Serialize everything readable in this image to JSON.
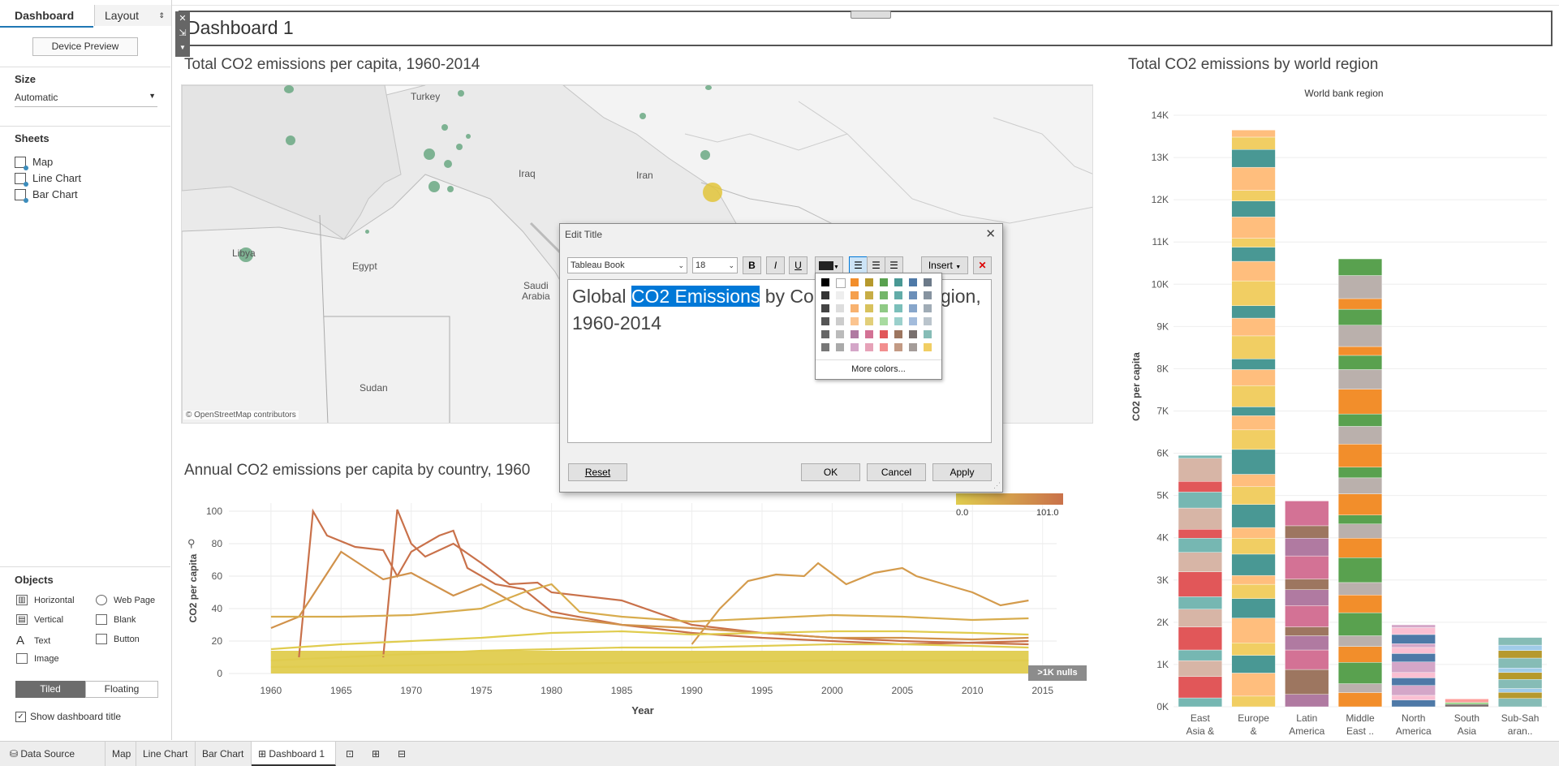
{
  "left_pane": {
    "tab_dashboard": "Dashboard",
    "tab_layout": "Layout",
    "device_preview": "Device Preview",
    "size_label": "Size",
    "size_value": "Automatic",
    "sheets_label": "Sheets",
    "sheets": [
      {
        "label": "Map"
      },
      {
        "label": "Line Chart"
      },
      {
        "label": "Bar Chart"
      }
    ],
    "objects_label": "Objects",
    "objects": [
      {
        "label": "Horizontal",
        "icon": "horizontal-icon"
      },
      {
        "label": "Web Page",
        "icon": "globe-icon"
      },
      {
        "label": "Vertical",
        "icon": "vertical-icon"
      },
      {
        "label": "Blank",
        "icon": "blank-icon"
      },
      {
        "label": "Text",
        "icon": "text-icon"
      },
      {
        "label": "Button",
        "icon": "button-icon"
      },
      {
        "label": "Image",
        "icon": "image-icon"
      }
    ],
    "tiled": "Tiled",
    "floating": "Floating",
    "show_title": "Show dashboard title"
  },
  "dashboard": {
    "title": "Dashboard 1",
    "map_title": "Total CO2 emissions per capita, 1960-2014",
    "map_attribution": "© OpenStreetMap contributors",
    "map_labels": {
      "turkey": "Turkey",
      "iraq": "Iraq",
      "iran": "Iran",
      "libya": "Libya",
      "egypt": "Egypt",
      "saudi": "Saudi",
      "arabia": "Arabia",
      "sudan": "Sudan"
    },
    "line_title": "Annual CO2 emissions per capita by country, 1960",
    "bar_title": "Total CO2 emissions by world region"
  },
  "dialog": {
    "title": "Edit Title",
    "font": "Tableau Book",
    "size": "18",
    "bold": "B",
    "italic": "I",
    "underline": "U",
    "insert": "Insert",
    "text_pre": "Global ",
    "text_sel": "CO2 Emissions",
    "text_mid": " by Co",
    "text_post": "gion,",
    "text_line2": "1960-2014",
    "more_colors": "More colors...",
    "reset": "Reset",
    "ok": "OK",
    "cancel": "Cancel",
    "apply": "Apply"
  },
  "legend": {
    "title_partial": "pita",
    "min": "0.0",
    "max": "101.0",
    "nulls": ">1K nulls"
  },
  "bottom_tabs": [
    {
      "label": "Data Source"
    },
    {
      "label": "Map"
    },
    {
      "label": "Line Chart"
    },
    {
      "label": "Bar Chart"
    },
    {
      "label": "Dashboard 1"
    }
  ],
  "colors": {
    "accent": "#0078d7",
    "map_dot": "#6aa882",
    "line_low": "#e0cc4e",
    "line_high": "#c9714a"
  },
  "chart_data": [
    {
      "type": "line",
      "title": "Annual CO2 emissions per capita by country, 1960",
      "xlabel": "Year",
      "ylabel": "CO2 per capita",
      "x_ticks": [
        "1960",
        "1965",
        "1970",
        "1975",
        "1980",
        "1985",
        "1990",
        "1995",
        "2000",
        "2005",
        "2010",
        "2015"
      ],
      "y_ticks": [
        "0",
        "20",
        "40",
        "60",
        "80",
        "100"
      ],
      "xlim": [
        1957,
        2016
      ],
      "ylim": [
        0,
        105
      ],
      "grid": true,
      "series": [
        {
          "values": [
            [
              1962,
              10
            ],
            [
              1963,
              100
            ],
            [
              1964,
              85
            ],
            [
              1966,
              78
            ],
            [
              1968,
              76
            ],
            [
              1969,
              60
            ],
            [
              1970,
              75
            ],
            [
              1972,
              85
            ],
            [
              1973,
              88
            ],
            [
              1974,
              65
            ],
            [
              1976,
              55
            ],
            [
              1978,
              52
            ],
            [
              1980,
              38
            ],
            [
              1985,
              30
            ],
            [
              1990,
              25
            ],
            [
              1995,
              22
            ],
            [
              2000,
              20
            ],
            [
              2005,
              18
            ],
            [
              2010,
              19
            ],
            [
              2014,
              20
            ]
          ]
        },
        {
          "values": [
            [
              1968,
              10
            ],
            [
              1969,
              101
            ],
            [
              1970,
              80
            ],
            [
              1971,
              72
            ],
            [
              1973,
              80
            ],
            [
              1975,
              68
            ],
            [
              1977,
              55
            ],
            [
              1979,
              56
            ],
            [
              1980,
              50
            ],
            [
              1985,
              45
            ],
            [
              1990,
              30
            ],
            [
              1995,
              25
            ],
            [
              2000,
              22
            ],
            [
              2005,
              20
            ],
            [
              2014,
              18
            ]
          ]
        },
        {
          "values": [
            [
              1960,
              28
            ],
            [
              1962,
              35
            ],
            [
              1965,
              75
            ],
            [
              1968,
              58
            ],
            [
              1970,
              62
            ],
            [
              1973,
              48
            ],
            [
              1975,
              55
            ],
            [
              1978,
              40
            ],
            [
              1980,
              35
            ],
            [
              1985,
              30
            ],
            [
              1990,
              28
            ],
            [
              1995,
              25
            ],
            [
              2000,
              22
            ],
            [
              2005,
              22
            ],
            [
              2010,
              21
            ],
            [
              2014,
              22
            ]
          ]
        },
        {
          "values": [
            [
              1990,
              18
            ],
            [
              1992,
              40
            ],
            [
              1994,
              57
            ],
            [
              1996,
              61
            ],
            [
              1998,
              60
            ],
            [
              1999,
              68
            ],
            [
              2001,
              55
            ],
            [
              2003,
              62
            ],
            [
              2005,
              65
            ],
            [
              2006,
              60
            ],
            [
              2008,
              55
            ],
            [
              2010,
              50
            ],
            [
              2012,
              42
            ],
            [
              2014,
              45
            ]
          ]
        },
        {
          "values": [
            [
              1960,
              35
            ],
            [
              1965,
              35
            ],
            [
              1970,
              36
            ],
            [
              1975,
              40
            ],
            [
              1978,
              50
            ],
            [
              1980,
              55
            ],
            [
              1982,
              38
            ],
            [
              1985,
              35
            ],
            [
              1990,
              32
            ],
            [
              1995,
              34
            ],
            [
              2000,
              36
            ],
            [
              2005,
              35
            ],
            [
              2010,
              33
            ],
            [
              2014,
              34
            ]
          ]
        },
        {
          "values": [
            [
              1960,
              15
            ],
            [
              1965,
              18
            ],
            [
              1970,
              20
            ],
            [
              1975,
              22
            ],
            [
              1980,
              25
            ],
            [
              1985,
              26
            ],
            [
              1990,
              24
            ],
            [
              1995,
              25
            ],
            [
              2000,
              26
            ],
            [
              2005,
              26
            ],
            [
              2010,
              25
            ],
            [
              2014,
              24
            ]
          ]
        },
        {
          "values": [
            [
              1960,
              8
            ],
            [
              1965,
              10
            ],
            [
              1970,
              12
            ],
            [
              1975,
              14
            ],
            [
              1980,
              15
            ],
            [
              1985,
              16
            ],
            [
              1990,
              16
            ],
            [
              1995,
              17
            ],
            [
              2000,
              18
            ],
            [
              2005,
              18
            ],
            [
              2010,
              17
            ],
            [
              2014,
              16
            ]
          ]
        },
        {
          "values": [
            [
              1960,
              4
            ],
            [
              1970,
              5
            ],
            [
              1980,
              6
            ],
            [
              1990,
              7
            ],
            [
              2000,
              8
            ],
            [
              2010,
              8
            ],
            [
              2014,
              8
            ]
          ]
        }
      ]
    },
    {
      "type": "bar",
      "title": "Total CO2 emissions by world region",
      "legend_title": "World bank region",
      "ylabel": "CO2 per capita",
      "categories": [
        "East Asia & Pacific",
        "Europe & Central ..",
        "Latin America ..",
        "Middle East ..",
        "North America",
        "South Asia",
        "Sub-Sah aran.."
      ],
      "values": [
        5950,
        13650,
        4870,
        10600,
        1940,
        190,
        1640
      ],
      "y_ticks": [
        "0K",
        "1K",
        "2K",
        "3K",
        "4K",
        "5K",
        "6K",
        "7K",
        "8K",
        "9K",
        "10K",
        "11K",
        "12K",
        "13K",
        "14K"
      ],
      "ylim": [
        0,
        14000
      ],
      "grid": true
    }
  ]
}
